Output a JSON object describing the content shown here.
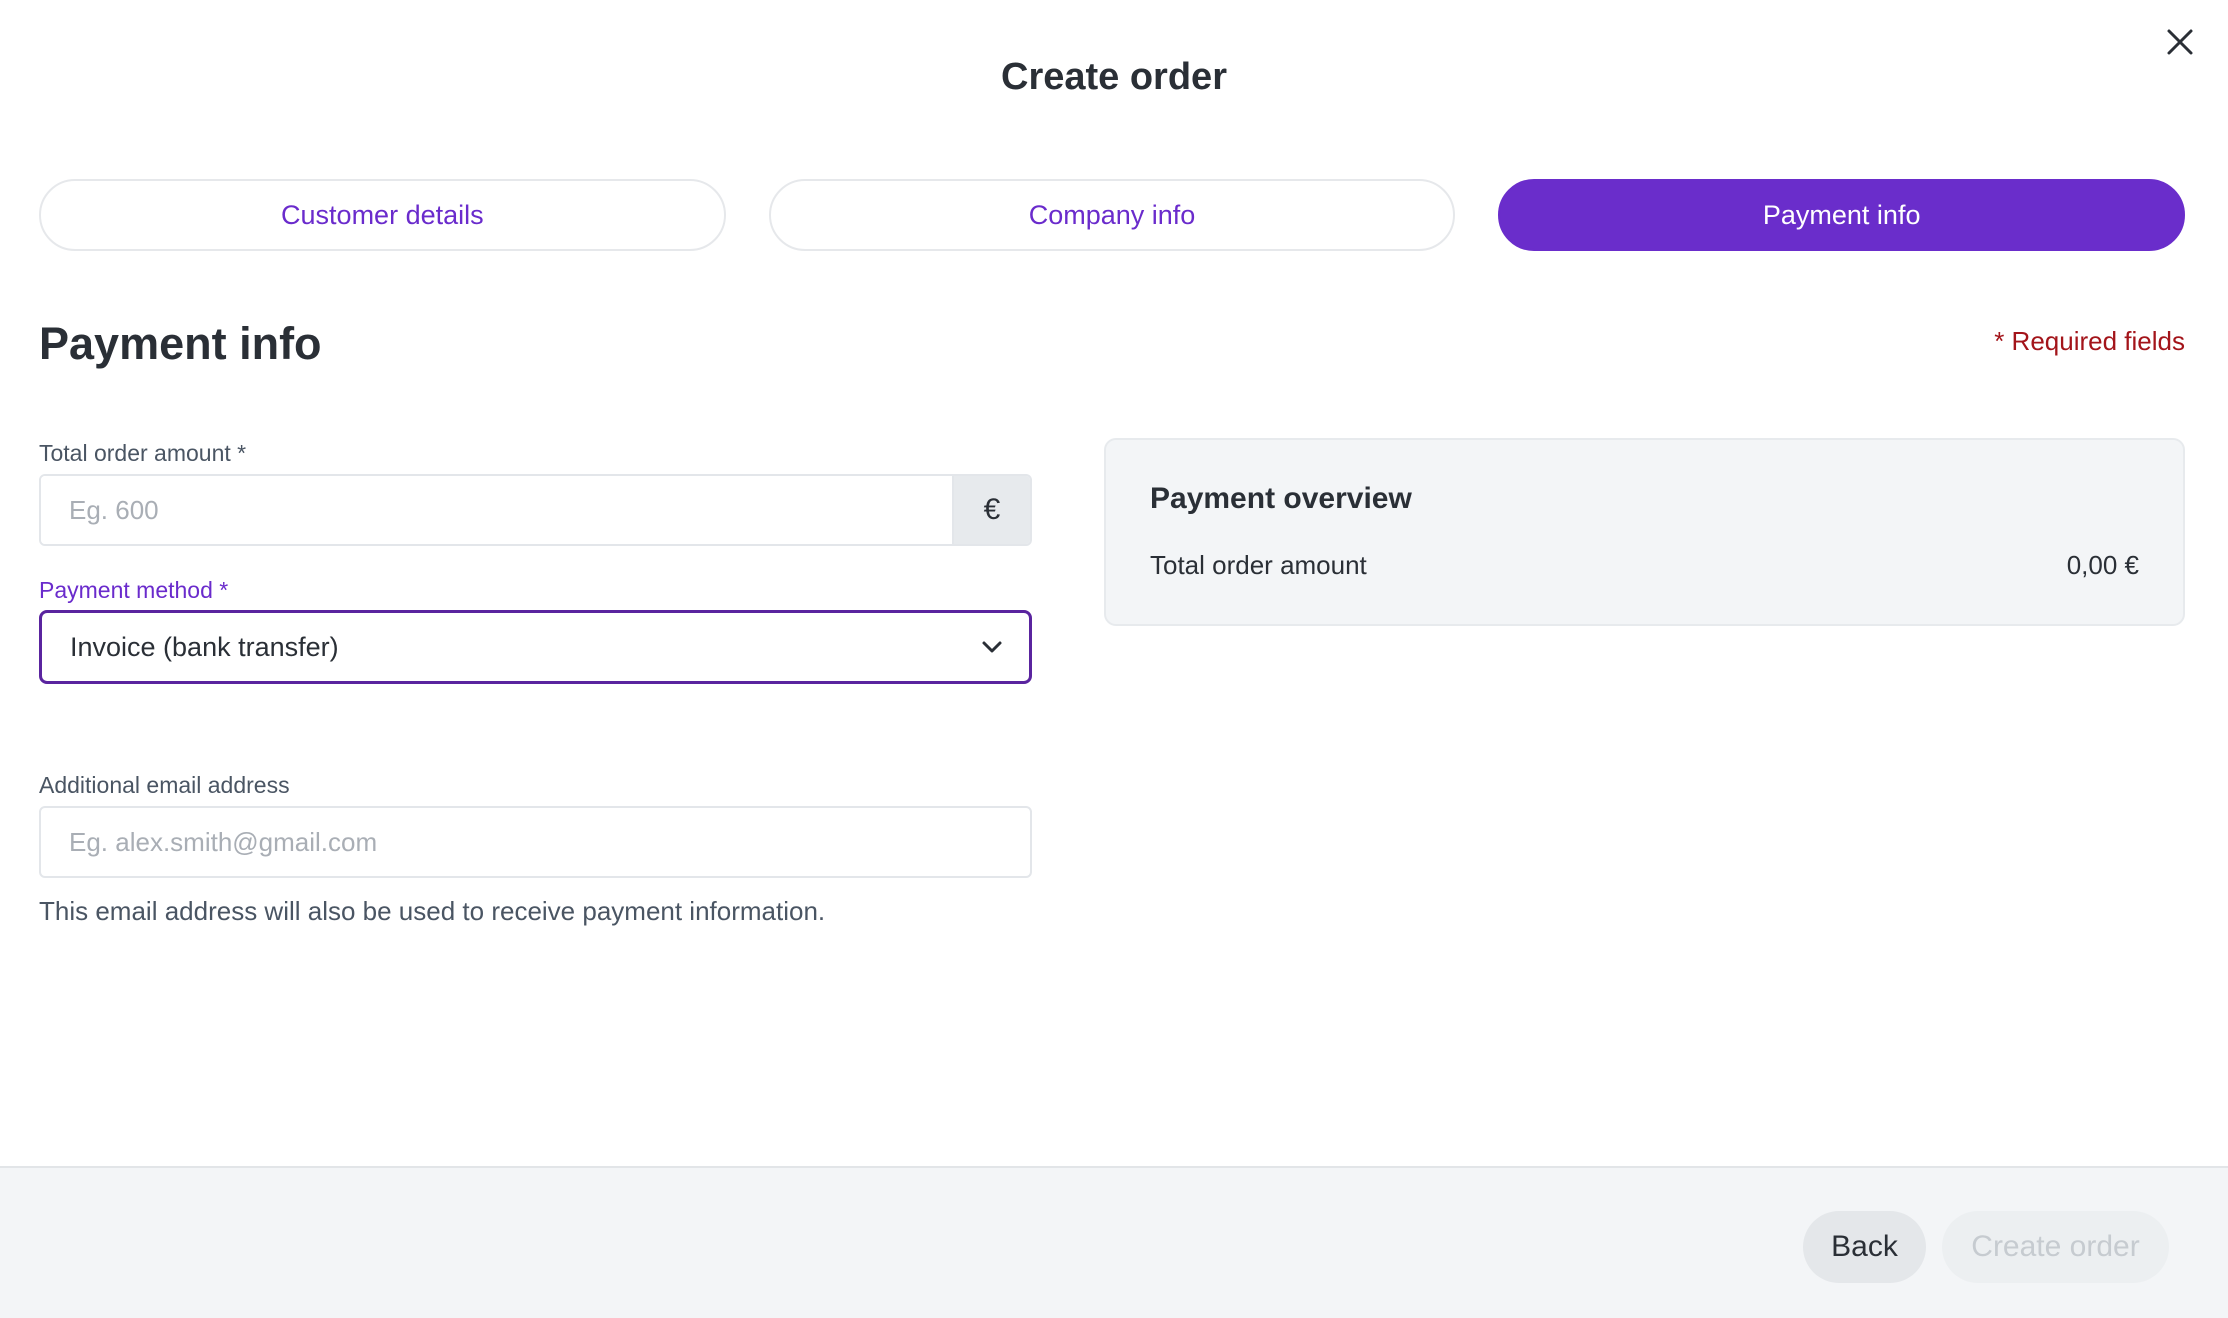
{
  "dialog": {
    "title": "Create order",
    "close_icon": "close-icon"
  },
  "steps": [
    {
      "label": "Customer details",
      "active": false
    },
    {
      "label": "Company info",
      "active": false
    },
    {
      "label": "Payment info",
      "active": true
    }
  ],
  "section": {
    "title": "Payment info",
    "required_note": "* Required fields"
  },
  "form": {
    "amount": {
      "label": "Total order amount *",
      "placeholder": "Eg. 600",
      "value": "",
      "currency": "€"
    },
    "payment_method": {
      "label": "Payment method *",
      "selected": "Invoice (bank transfer)",
      "icon": "chevron-down-icon"
    },
    "email": {
      "label": "Additional email address",
      "placeholder": "Eg. alex.smith@gmail.com",
      "value": "",
      "helper": "This email address will also be used to receive payment information."
    }
  },
  "overview": {
    "title": "Payment overview",
    "total_label": "Total order amount",
    "total_value": "0,00 €"
  },
  "footer": {
    "back_label": "Back",
    "create_label": "Create order"
  },
  "colors": {
    "accent": "#6a2dcb",
    "required": "#a3141a",
    "panel_bg": "#f3f5f7"
  }
}
